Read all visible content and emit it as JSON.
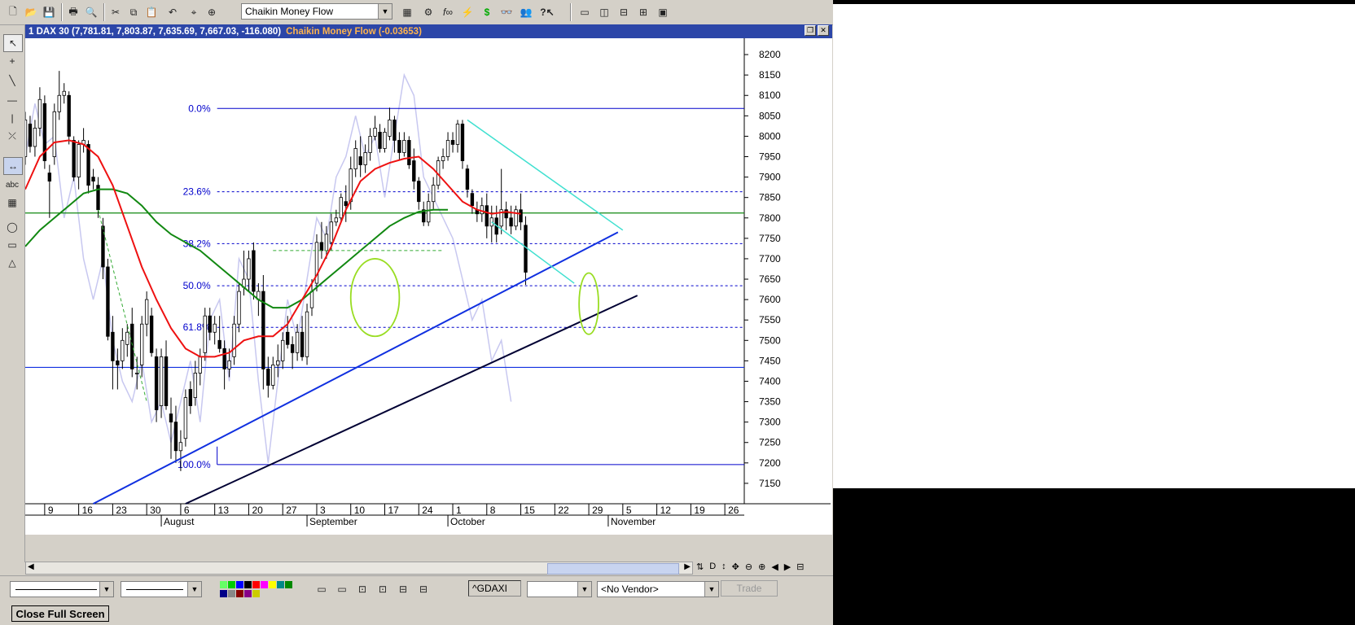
{
  "toolbar": {
    "indicator_combo": "Chaikin Money Flow",
    "icons": [
      "new-icon",
      "open-icon",
      "save-icon",
      "print-icon",
      "print-preview-icon",
      "cut-icon",
      "copy-icon",
      "paste-icon",
      "undo-icon",
      "crosshair-icon",
      "zoom-icon",
      "indicator-icon",
      "settings-icon",
      "formula-icon",
      "expert-icon",
      "dollar-icon",
      "binoculars-icon",
      "group-icon",
      "help-icon",
      "window-icon",
      "tile-icon",
      "split-icon",
      "grid-icon",
      "palette-icon"
    ]
  },
  "window": {
    "title_main": "1 DAX 30 (7,781.81, 7,803.87, 7,635.69, 7,667.03, -116.080)",
    "title_indicator": "Chaikin Money Flow (-0.03653)"
  },
  "colors": {
    "title_bg": "#2c46a8",
    "indicator_text": "#ffb44d",
    "fib_blue": "#0000cc",
    "ma_red": "#ee1111",
    "ma_green": "#118811",
    "cmf_line": "#c8c8f0",
    "trend_blue": "#1030e0",
    "trend_black": "#000033",
    "channel_cyan": "#40e0d0",
    "ellipse_green": "#99dd22",
    "bull_candle": "#ffffff",
    "bear_candle": "#000000"
  },
  "chart_data": {
    "type": "candlestick",
    "y_ticks": [
      8200,
      8150,
      8100,
      8050,
      8000,
      7950,
      7900,
      7850,
      7800,
      7750,
      7700,
      7650,
      7600,
      7550,
      7500,
      7450,
      7400,
      7350,
      7300,
      7250,
      7200,
      7150
    ],
    "y_tick_labels": [
      "8200",
      "8150",
      "8100",
      "8050",
      "8000",
      "7950",
      "7900",
      "7850",
      "7800",
      "7750",
      "7700",
      "7650",
      "7600",
      "7550",
      "7500",
      "7450",
      "7400",
      "7350",
      "7300",
      "7250",
      "7200",
      "7150"
    ],
    "ylim": [
      7100,
      8240
    ],
    "x_day_ticks": [
      {
        "label": "9",
        "x": 9
      },
      {
        "label": "16",
        "x": 16
      },
      {
        "label": "23",
        "x": 23
      },
      {
        "label": "30",
        "x": 30
      },
      {
        "label": "6",
        "x": 37
      },
      {
        "label": "13",
        "x": 44
      },
      {
        "label": "20",
        "x": 51
      },
      {
        "label": "27",
        "x": 58
      },
      {
        "label": "3",
        "x": 65
      },
      {
        "label": "10",
        "x": 72
      },
      {
        "label": "17",
        "x": 79
      },
      {
        "label": "24",
        "x": 86
      },
      {
        "label": "1",
        "x": 93
      },
      {
        "label": "8",
        "x": 100
      },
      {
        "label": "15",
        "x": 107
      },
      {
        "label": "22",
        "x": 114
      },
      {
        "label": "29",
        "x": 121
      },
      {
        "label": "5",
        "x": 128
      },
      {
        "label": "12",
        "x": 135
      },
      {
        "label": "19",
        "x": 142
      },
      {
        "label": "26",
        "x": 149
      }
    ],
    "x_month_ticks": [
      {
        "label": "August",
        "x": 33
      },
      {
        "label": "September",
        "x": 63
      },
      {
        "label": "October",
        "x": 92
      },
      {
        "label": "November",
        "x": 125
      }
    ],
    "xlim": [
      5,
      153
    ],
    "fib_levels": [
      {
        "label": "0.0%",
        "value": 8068
      },
      {
        "label": "23.6%",
        "value": 7864
      },
      {
        "label": "38.2%",
        "value": 7737
      },
      {
        "label": "50.0%",
        "value": 7634
      },
      {
        "label": "61.8%",
        "value": 7532
      },
      {
        "label": "100.0%",
        "value": 7196
      }
    ],
    "horizontal_lines": [
      {
        "value": 7812,
        "color": "#118811"
      },
      {
        "value": 7434,
        "color": "#1030e0"
      }
    ],
    "candles": [
      [
        5,
        7950,
        8060,
        7930,
        8040
      ],
      [
        6,
        8030,
        8050,
        7960,
        7975
      ],
      [
        7,
        7975,
        8040,
        7950,
        8020
      ],
      [
        8,
        8020,
        8120,
        8000,
        8090
      ],
      [
        9,
        8080,
        8100,
        7920,
        7940
      ],
      [
        10,
        7910,
        7930,
        7800,
        7890
      ],
      [
        11,
        7950,
        8080,
        7930,
        8060
      ],
      [
        12,
        8060,
        8160,
        8040,
        8100
      ],
      [
        13,
        8100,
        8130,
        8080,
        8110
      ],
      [
        14,
        8100,
        8110,
        7980,
        8000
      ],
      [
        15,
        7990,
        8000,
        7890,
        7900
      ],
      [
        16,
        7900,
        7990,
        7870,
        7980
      ],
      [
        17,
        7980,
        8020,
        7960,
        7990
      ],
      [
        18,
        7980,
        7990,
        7860,
        7880
      ],
      [
        19,
        7900,
        7920,
        7870,
        7890
      ],
      [
        20,
        7880,
        7900,
        7800,
        7820
      ],
      [
        21,
        7780,
        7800,
        7650,
        7680
      ],
      [
        22,
        7680,
        7700,
        7500,
        7510
      ],
      [
        23,
        7520,
        7560,
        7380,
        7450
      ],
      [
        24,
        7450,
        7480,
        7380,
        7440
      ],
      [
        25,
        7450,
        7530,
        7430,
        7500
      ],
      [
        26,
        7490,
        7540,
        7460,
        7520
      ],
      [
        27,
        7540,
        7580,
        7410,
        7430
      ],
      [
        28,
        7420,
        7460,
        7380,
        7420
      ],
      [
        29,
        7440,
        7560,
        7410,
        7540
      ],
      [
        30,
        7540,
        7620,
        7510,
        7600
      ],
      [
        31,
        7560,
        7580,
        7460,
        7470
      ],
      [
        32,
        7460,
        7480,
        7300,
        7330
      ],
      [
        33,
        7340,
        7480,
        7310,
        7460
      ],
      [
        34,
        7460,
        7500,
        7330,
        7340
      ],
      [
        35,
        7320,
        7360,
        7210,
        7300
      ],
      [
        36,
        7300,
        7340,
        7200,
        7230
      ],
      [
        37,
        7230,
        7280,
        7180,
        7250
      ],
      [
        38,
        7260,
        7380,
        7240,
        7360
      ],
      [
        39,
        7380,
        7400,
        7320,
        7340
      ],
      [
        40,
        7360,
        7450,
        7340,
        7420
      ],
      [
        41,
        7420,
        7480,
        7390,
        7460
      ],
      [
        42,
        7470,
        7580,
        7450,
        7560
      ],
      [
        43,
        7560,
        7580,
        7500,
        7520
      ],
      [
        44,
        7520,
        7560,
        7490,
        7540
      ],
      [
        45,
        7500,
        7560,
        7470,
        7480
      ],
      [
        46,
        7480,
        7500,
        7380,
        7430
      ],
      [
        47,
        7430,
        7480,
        7410,
        7450
      ],
      [
        48,
        7460,
        7560,
        7440,
        7540
      ],
      [
        49,
        7540,
        7640,
        7520,
        7620
      ],
      [
        50,
        7630,
        7720,
        7610,
        7650
      ],
      [
        51,
        7650,
        7720,
        7620,
        7700
      ],
      [
        52,
        7720,
        7740,
        7600,
        7620
      ],
      [
        53,
        7600,
        7640,
        7560,
        7620
      ],
      [
        54,
        7620,
        7660,
        7380,
        7430
      ],
      [
        55,
        7430,
        7460,
        7360,
        7390
      ],
      [
        56,
        7390,
        7460,
        7380,
        7440
      ],
      [
        57,
        7440,
        7490,
        7410,
        7450
      ],
      [
        58,
        7450,
        7520,
        7430,
        7500
      ],
      [
        59,
        7520,
        7560,
        7480,
        7490
      ],
      [
        60,
        7490,
        7510,
        7430,
        7470
      ],
      [
        61,
        7470,
        7540,
        7450,
        7520
      ],
      [
        62,
        7520,
        7560,
        7450,
        7460
      ],
      [
        63,
        7460,
        7590,
        7440,
        7570
      ],
      [
        64,
        7580,
        7650,
        7560,
        7620
      ],
      [
        65,
        7640,
        7760,
        7620,
        7740
      ],
      [
        66,
        7740,
        7790,
        7700,
        7720
      ],
      [
        67,
        7720,
        7780,
        7700,
        7760
      ],
      [
        68,
        7740,
        7810,
        7720,
        7790
      ],
      [
        69,
        7790,
        7820,
        7780,
        7800
      ],
      [
        70,
        7800,
        7860,
        7790,
        7850
      ],
      [
        71,
        7840,
        7880,
        7790,
        7830
      ],
      [
        72,
        7840,
        7950,
        7820,
        7920
      ],
      [
        73,
        7920,
        7990,
        7900,
        7970
      ],
      [
        74,
        7950,
        8000,
        7900,
        7930
      ],
      [
        75,
        7930,
        7980,
        7910,
        7960
      ],
      [
        76,
        7960,
        8020,
        7940,
        8000
      ],
      [
        77,
        8000,
        8050,
        7990,
        8020
      ],
      [
        78,
        8010,
        8030,
        7960,
        7970
      ],
      [
        79,
        7970,
        8020,
        7960,
        8010
      ],
      [
        80,
        8000,
        8070,
        7990,
        8040
      ],
      [
        81,
        8040,
        8050,
        7960,
        7990
      ],
      [
        82,
        7990,
        8010,
        7940,
        7960
      ],
      [
        83,
        7960,
        8010,
        7950,
        7990
      ],
      [
        84,
        7990,
        8000,
        7920,
        7930
      ],
      [
        85,
        7940,
        7970,
        7870,
        7890
      ],
      [
        86,
        7890,
        7900,
        7820,
        7840
      ],
      [
        87,
        7820,
        7840,
        7780,
        7790
      ],
      [
        88,
        7790,
        7860,
        7780,
        7840
      ],
      [
        89,
        7840,
        7900,
        7820,
        7880
      ],
      [
        90,
        7880,
        7950,
        7870,
        7940
      ],
      [
        91,
        7940,
        7970,
        7920,
        7950
      ],
      [
        92,
        7950,
        8010,
        7940,
        7990
      ],
      [
        93,
        7990,
        8010,
        7960,
        7980
      ],
      [
        94,
        7980,
        8040,
        7960,
        8030
      ],
      [
        95,
        8030,
        8040,
        7920,
        7940
      ],
      [
        96,
        7920,
        7930,
        7850,
        7870
      ],
      [
        97,
        7860,
        7870,
        7810,
        7830
      ],
      [
        98,
        7820,
        7840,
        7790,
        7810
      ],
      [
        99,
        7810,
        7850,
        7790,
        7830
      ],
      [
        100,
        7830,
        7860,
        7750,
        7780
      ],
      [
        101,
        7780,
        7830,
        7740,
        7800
      ],
      [
        102,
        7800,
        7830,
        7740,
        7760
      ],
      [
        103,
        7780,
        7920,
        7760,
        7820
      ],
      [
        104,
        7820,
        7840,
        7770,
        7800
      ],
      [
        105,
        7800,
        7830,
        7760,
        7780
      ],
      [
        106,
        7780,
        7830,
        7770,
        7820
      ],
      [
        107,
        7820,
        7860,
        7770,
        7790
      ],
      [
        108,
        7782,
        7804,
        7636,
        7667
      ]
    ],
    "ma_red": [
      [
        5,
        7870
      ],
      [
        8,
        7950
      ],
      [
        11,
        7985
      ],
      [
        14,
        7990
      ],
      [
        17,
        7980
      ],
      [
        20,
        7950
      ],
      [
        23,
        7880
      ],
      [
        26,
        7780
      ],
      [
        29,
        7680
      ],
      [
        32,
        7600
      ],
      [
        35,
        7530
      ],
      [
        38,
        7480
      ],
      [
        41,
        7460
      ],
      [
        44,
        7460
      ],
      [
        47,
        7470
      ],
      [
        50,
        7500
      ],
      [
        53,
        7510
      ],
      [
        56,
        7510
      ],
      [
        59,
        7540
      ],
      [
        62,
        7600
      ],
      [
        65,
        7660
      ],
      [
        68,
        7730
      ],
      [
        71,
        7820
      ],
      [
        74,
        7890
      ],
      [
        77,
        7920
      ],
      [
        80,
        7935
      ],
      [
        83,
        7945
      ],
      [
        86,
        7950
      ],
      [
        89,
        7920
      ],
      [
        92,
        7880
      ],
      [
        95,
        7840
      ],
      [
        98,
        7820
      ],
      [
        101,
        7810
      ],
      [
        104,
        7815
      ],
      [
        107,
        7810
      ]
    ],
    "ma_green": [
      [
        5,
        7730
      ],
      [
        8,
        7770
      ],
      [
        11,
        7800
      ],
      [
        14,
        7830
      ],
      [
        17,
        7860
      ],
      [
        20,
        7870
      ],
      [
        23,
        7870
      ],
      [
        26,
        7860
      ],
      [
        29,
        7830
      ],
      [
        32,
        7790
      ],
      [
        35,
        7760
      ],
      [
        38,
        7740
      ],
      [
        41,
        7720
      ],
      [
        44,
        7690
      ],
      [
        47,
        7660
      ],
      [
        50,
        7630
      ],
      [
        53,
        7600
      ],
      [
        56,
        7580
      ],
      [
        59,
        7580
      ],
      [
        62,
        7600
      ],
      [
        65,
        7630
      ],
      [
        68,
        7660
      ],
      [
        71,
        7690
      ],
      [
        74,
        7720
      ],
      [
        77,
        7750
      ],
      [
        80,
        7780
      ],
      [
        83,
        7800
      ],
      [
        86,
        7815
      ],
      [
        89,
        7820
      ],
      [
        92,
        7820
      ]
    ],
    "cmf_line": [
      [
        5,
        7950
      ],
      [
        7,
        8080
      ],
      [
        9,
        7980
      ],
      [
        11,
        8000
      ],
      [
        13,
        7800
      ],
      [
        15,
        7900
      ],
      [
        17,
        7700
      ],
      [
        19,
        7600
      ],
      [
        21,
        7700
      ],
      [
        23,
        7500
      ],
      [
        25,
        7400
      ],
      [
        27,
        7350
      ],
      [
        29,
        7450
      ],
      [
        31,
        7300
      ],
      [
        33,
        7350
      ],
      [
        35,
        7250
      ],
      [
        37,
        7350
      ],
      [
        39,
        7450
      ],
      [
        41,
        7300
      ],
      [
        43,
        7550
      ],
      [
        45,
        7600
      ],
      [
        47,
        7400
      ],
      [
        49,
        7700
      ],
      [
        51,
        7650
      ],
      [
        53,
        7400
      ],
      [
        55,
        7200
      ],
      [
        57,
        7400
      ],
      [
        59,
        7600
      ],
      [
        61,
        7500
      ],
      [
        63,
        7650
      ],
      [
        65,
        7800
      ],
      [
        67,
        7750
      ],
      [
        69,
        7900
      ],
      [
        71,
        7950
      ],
      [
        73,
        8050
      ],
      [
        75,
        7950
      ],
      [
        77,
        8000
      ],
      [
        79,
        7850
      ],
      [
        81,
        8000
      ],
      [
        83,
        8150
      ],
      [
        85,
        8100
      ],
      [
        87,
        7900
      ],
      [
        89,
        7850
      ],
      [
        91,
        7800
      ],
      [
        93,
        7750
      ],
      [
        95,
        7650
      ],
      [
        97,
        7550
      ],
      [
        99,
        7600
      ],
      [
        101,
        7450
      ],
      [
        103,
        7500
      ],
      [
        105,
        7350
      ]
    ],
    "trendlines": [
      {
        "points": [
          [
            19,
            7100
          ],
          [
            127,
            7765
          ]
        ],
        "color": "#1030e0",
        "width": 2
      },
      {
        "points": [
          [
            38,
            7100
          ],
          [
            131,
            7610
          ]
        ],
        "color": "#000033",
        "width": 2
      },
      {
        "points": [
          [
            96,
            8040
          ],
          [
            128,
            7770
          ]
        ],
        "color": "#40e0d0",
        "width": 1.5
      },
      {
        "points": [
          [
            101,
            7790
          ],
          [
            118,
            7640
          ]
        ],
        "color": "#40e0d0",
        "width": 1.5
      },
      {
        "points": [
          [
            20,
            7820
          ],
          [
            30,
            7350
          ]
        ],
        "color": "#33aa33",
        "width": 1,
        "dash": true
      },
      {
        "points": [
          [
            56,
            7720
          ],
          [
            91,
            7720
          ]
        ],
        "color": "#33aa33",
        "width": 1,
        "dash": true
      }
    ],
    "ellipses": [
      {
        "cx": 77,
        "cy": 7605,
        "rx": 5,
        "ry": 95,
        "color": "#99dd22"
      },
      {
        "cx": 121,
        "cy": 7590,
        "rx": 2,
        "ry": 75,
        "color": "#99dd22"
      }
    ]
  },
  "bottom": {
    "symbol_box": "^GDAXI",
    "vendor_combo": "<No Vendor>",
    "trade_button": "Trade",
    "close_full_screen": "Close Full Screen"
  }
}
